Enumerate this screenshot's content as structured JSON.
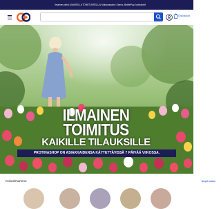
{
  "topbar": {
    "text": "Ilmainen päivä ILMAISELLA TOIMITUKSELLA | Maksutapoina: Klarna, MobilePay, luottokortit"
  },
  "header": {
    "logo_alt": "Protina logo",
    "search": {
      "placeholder": "",
      "icon": "search-icon"
    },
    "account_icon": "user-icon",
    "cart": {
      "label": "Ostoskori",
      "icon": "cart-icon"
    }
  },
  "hero": {
    "headline_1": "ILMAINEN TOIMITUS",
    "headline_2": "KAIKILLE TILAUKSILLE",
    "subtext": "PROTINASHOP ON ASIAKKAIDENSA KÄYTETTÄVISSÄ 7 PÄIVÄÄ VIIKOSSA."
  },
  "section": {
    "title": "Kokoelmamme",
    "link": "Näytä kaikki"
  },
  "colors": {
    "brand_navy": "#1c1c56",
    "brand_blue": "#1c52c5",
    "logo_orange": "#f0642a"
  }
}
